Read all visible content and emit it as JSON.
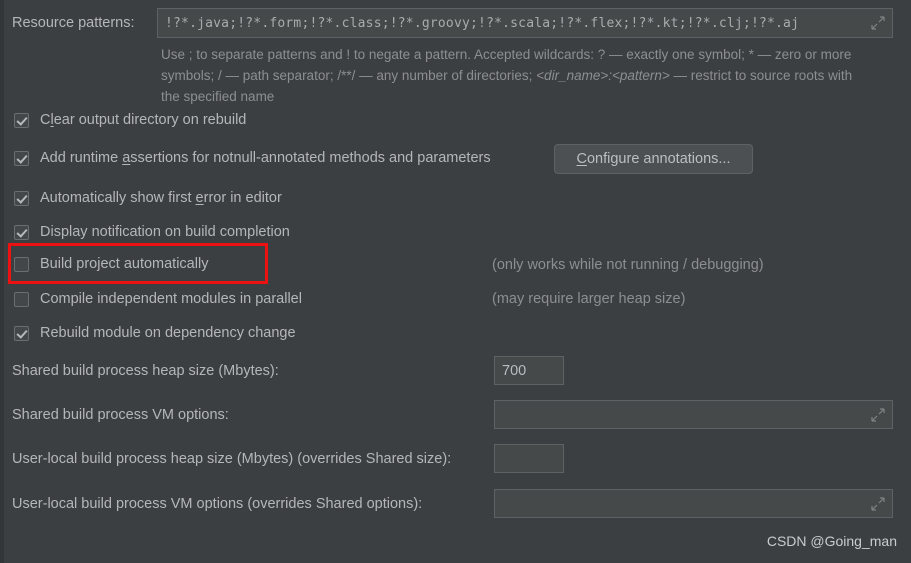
{
  "colors": {
    "background": "#3c3f41",
    "field_bg": "#45494a",
    "border": "#5e6264",
    "text": "#b4b7b9",
    "hint_text": "#8c8f91",
    "highlight": "#ee1111"
  },
  "resource_patterns": {
    "label": "Resource patterns:",
    "value": "!?*.java;!?*.form;!?*.class;!?*.groovy;!?*.scala;!?*.flex;!?*.kt;!?*.clj;!?*.aj",
    "expand_icon": "expand-diagonal-icon"
  },
  "help": {
    "line1": "Use ; to separate patterns and ! to negate a pattern. Accepted wildcards: ? — exactly one symbol; * — zero or more",
    "line2_a": "symbols; / — path separator; /**/ — any number of directories; ",
    "line2_italic": "<dir_name>:<pattern>",
    "line2_b": " — restrict to source roots with",
    "line3": "the specified name"
  },
  "checkboxes": [
    {
      "name": "clear-output-directory-on-rebuild",
      "label": "Clear output directory on rebuild",
      "checked": true,
      "mnemonic_index": 1
    },
    {
      "name": "add-runtime-assertions",
      "label": "Add runtime assertions for notnull-annotated methods and parameters",
      "checked": true,
      "mnemonic_index": 12
    },
    {
      "name": "automatically-show-first-error",
      "label": "Automatically show first error in editor",
      "checked": true,
      "mnemonic_index": 27
    },
    {
      "name": "display-notification-on-build-completion",
      "label": "Display notification on build completion",
      "checked": true,
      "mnemonic_index": -1
    },
    {
      "name": "build-project-automatically",
      "label": "Build project automatically",
      "checked": false,
      "mnemonic_index": -1
    },
    {
      "name": "compile-independent-modules-in-parallel",
      "label": "Compile independent modules in parallel",
      "checked": false,
      "mnemonic_index": -1
    },
    {
      "name": "rebuild-module-on-dependency-change",
      "label": "Rebuild module on dependency change",
      "checked": true,
      "mnemonic_index": -1
    }
  ],
  "configure_annotations_button": {
    "label": "Configure annotations...",
    "mnemonic_index": 0
  },
  "side_hints": {
    "build_project_automatically": "(only works while not running / debugging)",
    "compile_independent_modules": "(may require larger heap size)"
  },
  "fields": [
    {
      "name": "shared-build-process-heap-size",
      "label": "Shared build process heap size (Mbytes):",
      "value": "700",
      "placeholder": "",
      "has_expand": false
    },
    {
      "name": "shared-build-process-vm-options",
      "label": "Shared build process VM options:",
      "value": "",
      "placeholder": "",
      "has_expand": true
    },
    {
      "name": "user-local-build-process-heap-size",
      "label": "User-local build process heap size (Mbytes) (overrides Shared size):",
      "value": "",
      "placeholder": "",
      "has_expand": false
    },
    {
      "name": "user-local-build-process-vm-options",
      "label": "User-local build process VM options (overrides Shared options):",
      "value": "",
      "placeholder": "",
      "has_expand": true
    }
  ],
  "annotation": {
    "name": "red-highlight-box",
    "target": "build-project-automatically"
  },
  "watermark": "CSDN @Going_man"
}
